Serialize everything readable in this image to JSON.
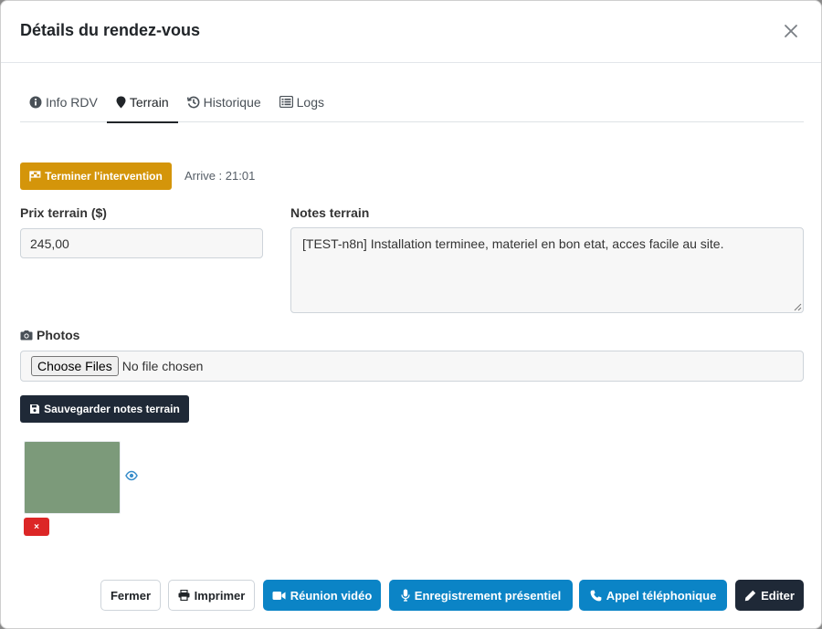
{
  "modal": {
    "title": "Détails du rendez-vous"
  },
  "tabs": [
    {
      "label": "Info RDV",
      "icon": "info-circle-icon",
      "active": false
    },
    {
      "label": "Terrain",
      "icon": "map-marker-icon",
      "active": true
    },
    {
      "label": "Historique",
      "icon": "history-icon",
      "active": false
    },
    {
      "label": "Logs",
      "icon": "list-icon",
      "active": false
    }
  ],
  "terrain": {
    "finish_button_label": "Terminer l'intervention",
    "arrival_text": "Arrive : 21:01",
    "price_label": "Prix terrain ($)",
    "price_value": "245,00",
    "notes_label": "Notes terrain",
    "notes_value": "[TEST-n8n] Installation terminee, materiel en bon etat, acces facile au site.",
    "photos_label": "Photos",
    "choose_files_label": "Choose Files",
    "file_status": "No file chosen",
    "save_button_label": "Sauvegarder notes terrain",
    "delete_photo_label": "×"
  },
  "footer": {
    "close_label": "Fermer",
    "print_label": "Imprimer",
    "video_label": "Réunion vidéo",
    "recording_label": "Enregistrement présentiel",
    "call_label": "Appel téléphonique",
    "edit_label": "Editer"
  },
  "colors": {
    "warning": "#d4950a",
    "info": "#0b84c6",
    "dark": "#1f2937",
    "danger": "#dc2626",
    "thumbnail": "#7c9a7a"
  }
}
